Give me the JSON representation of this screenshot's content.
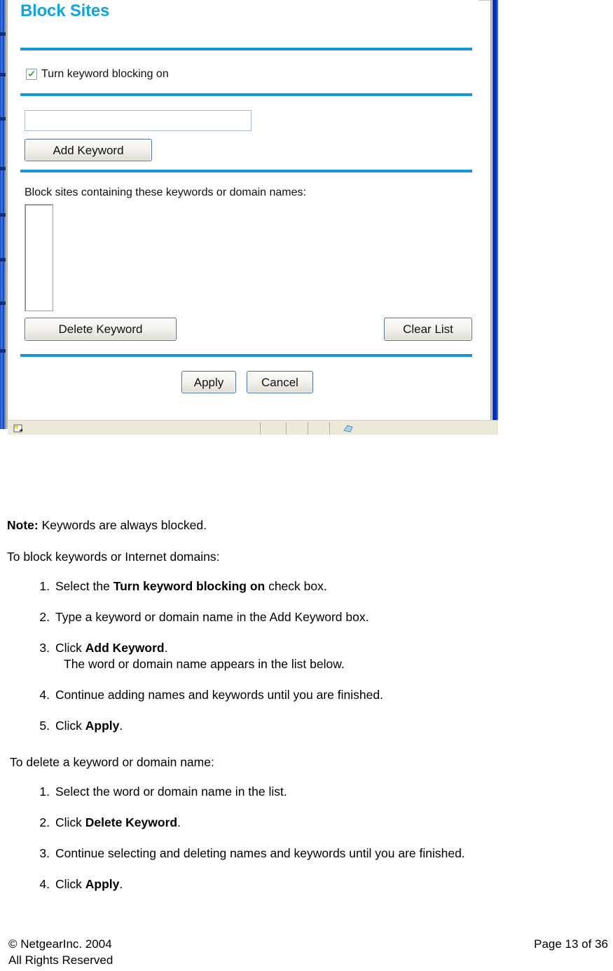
{
  "browser": {
    "page": {
      "title": "Block Sites",
      "checkbox": {
        "label": "Turn keyword blocking on",
        "checked": "true"
      },
      "keyword_input": {
        "value": "",
        "placeholder": ""
      },
      "add_keyword_button": "Add Keyword",
      "list_label": "Block sites containing these keywords or domain names:",
      "keyword_list_items": [],
      "delete_keyword_button": "Delete Keyword",
      "clear_list_button": "Clear List",
      "apply_button": "Apply",
      "cancel_button": "Cancel"
    },
    "scrollbar": {
      "down_arrow_icon": "chevron-down-icon"
    },
    "status_bar": {
      "left_icon": "page-document-icon",
      "network_icon": "internet-zone-icon"
    },
    "colors": {
      "heading": "#12a4dd",
      "rule": "#0e9bd4",
      "window_frame": "#0a2fb0",
      "button_border": "#4a6fae",
      "checkbox_check": "#2a9b2a"
    }
  },
  "document": {
    "note": {
      "label": "Note:",
      "text": "Keywords are always blocked."
    },
    "block_intro": "To block keywords or Internet domains:",
    "block_steps": [
      {
        "num": "1.",
        "pre": "Select the ",
        "bold": "Turn keyword blocking on",
        "post": " check box.",
        "sub": ""
      },
      {
        "num": "2.",
        "pre": "Type a keyword or domain name in the Add Keyword box.",
        "bold": "",
        "post": "",
        "sub": ""
      },
      {
        "num": "3.",
        "pre": "Click ",
        "bold": "Add Keyword",
        "post": ".",
        "sub": "The word or domain name appears in the list below."
      },
      {
        "num": "4.",
        "pre": "Continue adding names and keywords until you are finished.",
        "bold": "",
        "post": "",
        "sub": ""
      },
      {
        "num": "5.",
        "pre": "Click ",
        "bold": "Apply",
        "post": ".",
        "sub": ""
      }
    ],
    "delete_intro": "To delete a keyword or domain name:",
    "delete_steps": [
      {
        "num": "1.",
        "pre": "Select the word or domain name in the list.",
        "bold": "",
        "post": "",
        "sub": ""
      },
      {
        "num": "2.",
        "pre": "Click ",
        "bold": "Delete Keyword",
        "post": ".",
        "sub": ""
      },
      {
        "num": "3.",
        "pre": "Continue selecting and deleting names and keywords until you are finished.",
        "bold": "",
        "post": "",
        "sub": ""
      },
      {
        "num": "4.",
        "pre": "Click ",
        "bold": "Apply",
        "post": ".",
        "sub": ""
      }
    ]
  },
  "footer": {
    "copyright_line1": "© NetgearInc. 2004",
    "copyright_line2": "All Rights Reserved",
    "page_number": "Page 13 of 36"
  }
}
